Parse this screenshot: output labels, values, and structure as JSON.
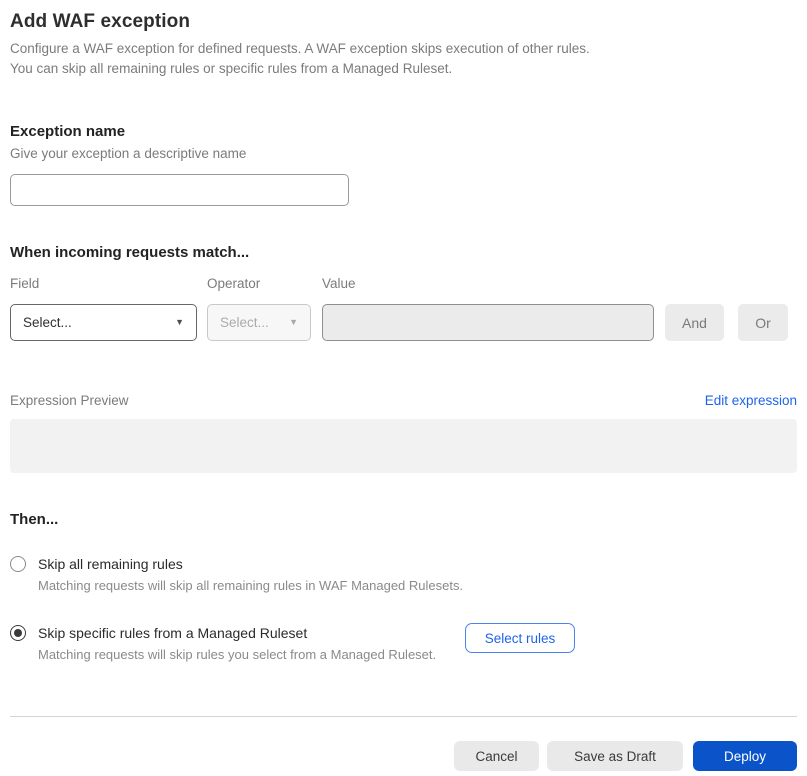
{
  "page": {
    "title": "Add WAF exception",
    "description_line1": "Configure a WAF exception for defined requests. A WAF exception skips execution of other rules.",
    "description_line2": "You can skip all remaining rules or specific rules from a Managed Ruleset."
  },
  "exception_name": {
    "label": "Exception name",
    "helper": "Give your exception a descriptive name",
    "value": "",
    "placeholder": ""
  },
  "match": {
    "heading": "When incoming requests match...",
    "field": {
      "label": "Field",
      "selected_value": "Select..."
    },
    "operator": {
      "label": "Operator",
      "selected_value": "Select...",
      "disabled": true
    },
    "value": {
      "label": "Value",
      "value": "",
      "disabled": true
    },
    "and_label": "And",
    "or_label": "Or"
  },
  "expression": {
    "label": "Expression Preview",
    "edit_link_label": "Edit expression",
    "preview_value": ""
  },
  "then": {
    "heading": "Then...",
    "options": [
      {
        "label": "Skip all remaining rules",
        "helper": "Matching requests will skip all remaining rules in WAF Managed Rulesets.",
        "selected": false
      },
      {
        "label": "Skip specific rules from a Managed Ruleset",
        "helper": "Matching requests will skip rules you select from a Managed Ruleset.",
        "selected": true
      }
    ],
    "select_rules_label": "Select rules"
  },
  "footer": {
    "cancel_label": "Cancel",
    "save_draft_label": "Save as Draft",
    "deploy_label": "Deploy"
  },
  "icons": {
    "dropdown_arrow": "▼"
  },
  "colors": {
    "primary_button_blue": "#0a53c8",
    "link_blue": "#2063eb",
    "disabled_gray": "#ebebeb",
    "preview_gray": "#f2f2f2"
  }
}
